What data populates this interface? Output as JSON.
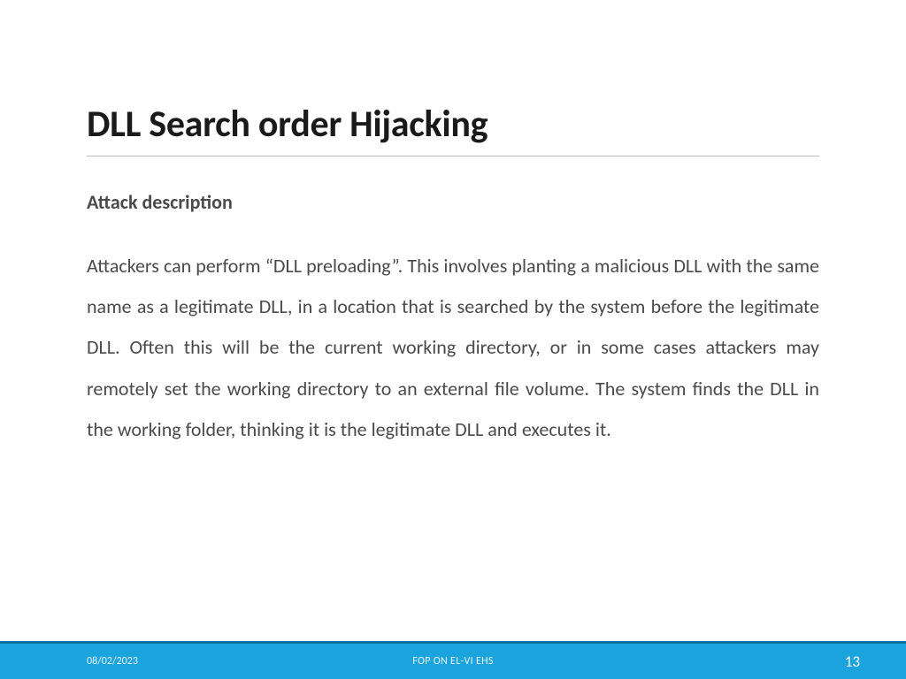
{
  "slide": {
    "title": "DLL Search order Hijacking",
    "subtitle": "Attack description",
    "body": "Attackers can perform “DLL preloading”. This involves planting a malicious DLL with the same name as a legitimate DLL, in a location that is searched by the system before the legitimate DLL. Often this will be the current working directory, or in some cases attackers may remotely set the working directory to an external file volume. The system finds the DLL in the working folder, thinking it is the legitimate DLL and executes it."
  },
  "footer": {
    "date": "08/02/2023",
    "center": "FOP ON EL-VI EHS",
    "page": "13"
  }
}
